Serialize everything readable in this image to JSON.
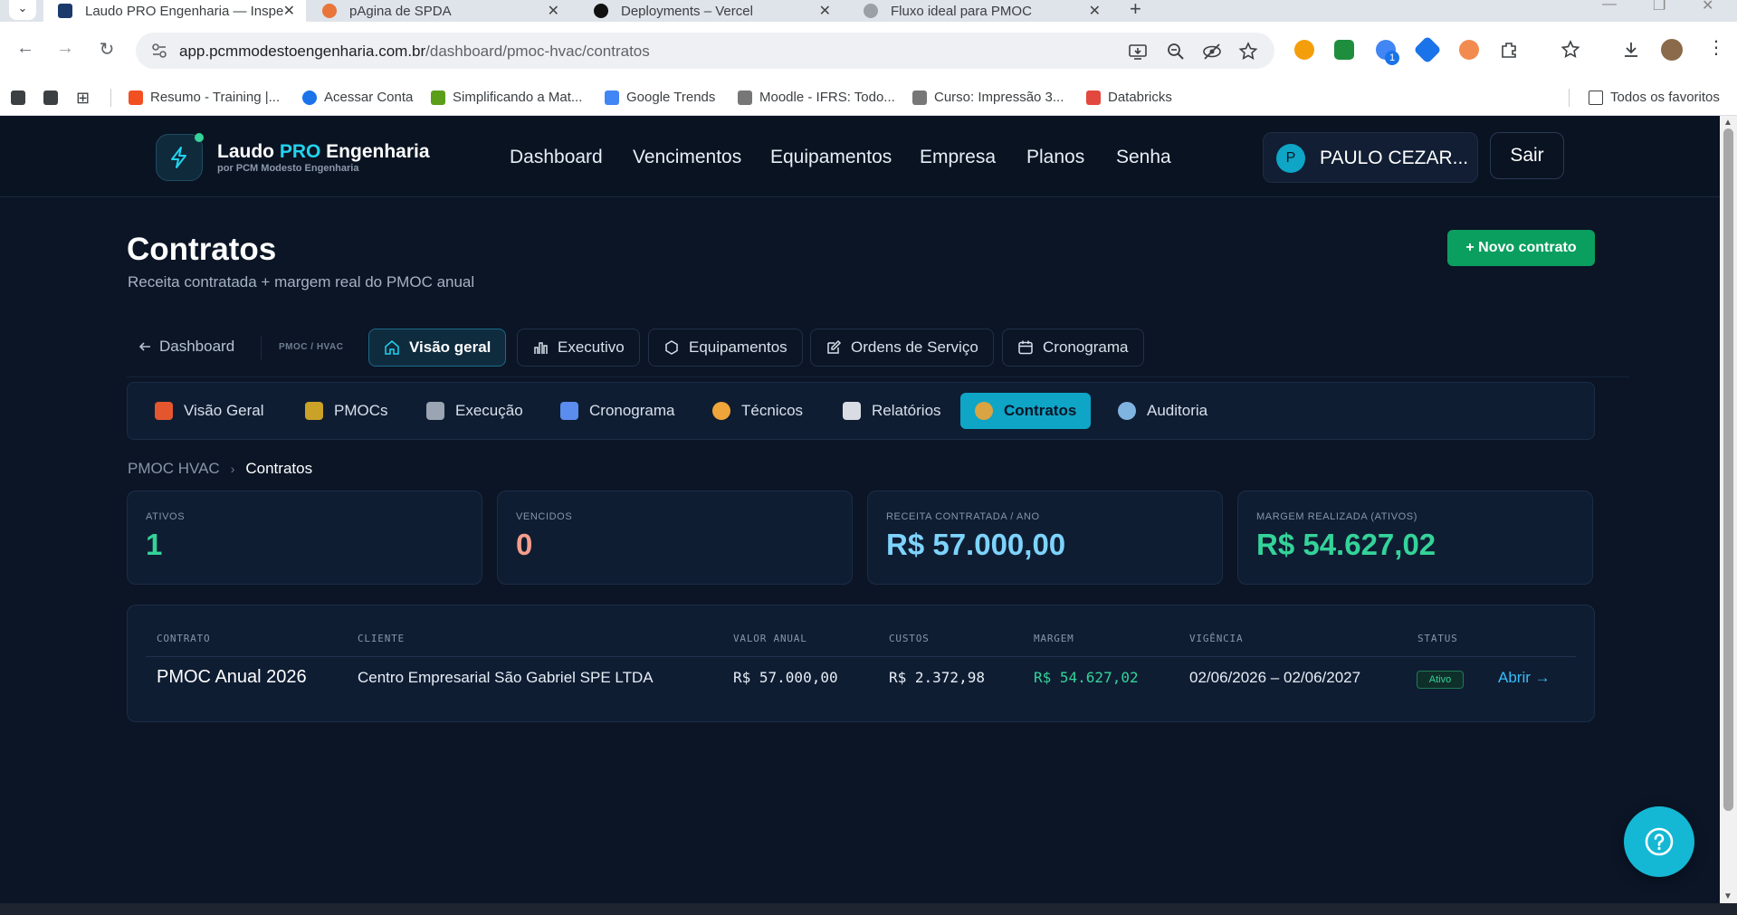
{
  "browser": {
    "tabs": [
      {
        "label": "Laudo PRO Engenharia — Inspe",
        "active": true,
        "color": "#1b3a6b"
      },
      {
        "label": "pAgina de SPDA",
        "active": false,
        "color": "#e8753a"
      },
      {
        "label": "Deployments – Vercel",
        "active": false,
        "color": "#111111"
      },
      {
        "label": "Fluxo ideal para PMOC",
        "active": false,
        "color": "#9aa0a6"
      }
    ],
    "url": {
      "host": "app.pcmmodestoengenharia.com.br",
      "path": "/dashboard/pmoc-hvac/contratos"
    },
    "bookmarks": [
      {
        "label": "Resumo - Training |...",
        "color": "#f25022"
      },
      {
        "label": "Acessar Conta",
        "color": "#1a73e8"
      },
      {
        "label": "Simplificando a Mat...",
        "color": "#5a9e1a"
      },
      {
        "label": "Google Trends",
        "color": "#4285f4"
      },
      {
        "label": "Moodle - IFRS: Todo...",
        "color": "#777777"
      },
      {
        "label": "Curso: Impressão 3...",
        "color": "#777777"
      },
      {
        "label": "Databricks",
        "color": "#e2483d"
      }
    ],
    "all_bookmarks_label": "Todos os favoritos",
    "extension_badge": "1"
  },
  "app": {
    "brand": {
      "name_a": "Laudo ",
      "name_pro": "PRO",
      "name_b": " Engenharia",
      "sub": "por PCM Modesto Engenharia"
    },
    "nav": [
      "Dashboard",
      "Vencimentos",
      "Equipamentos",
      "Empresa",
      "Planos",
      "Senha"
    ],
    "user": {
      "initial": "P",
      "name": "PAULO CEZAR..."
    },
    "logout_label": "Sair"
  },
  "page": {
    "title": "Contratos",
    "subtitle": "Receita contratada + margem real do PMOC anual",
    "new_button": "+ Novo contrato"
  },
  "subnav": {
    "back_label": "Dashboard",
    "section_label": "PMOC / HVAC",
    "items": [
      {
        "label": "Visão geral",
        "active": true,
        "icon": "home-icon"
      },
      {
        "label": "Executivo",
        "active": false,
        "icon": "bar-chart-icon"
      },
      {
        "label": "Equipamentos",
        "active": false,
        "icon": "hexagon-icon"
      },
      {
        "label": "Ordens de Serviço",
        "active": false,
        "icon": "edit-icon"
      },
      {
        "label": "Cronograma",
        "active": false,
        "icon": "calendar-icon"
      }
    ]
  },
  "modules": [
    {
      "label": "Visão Geral",
      "icon": "house-emoji-icon",
      "active": false,
      "color": "#e4572e"
    },
    {
      "label": "PMOCs",
      "icon": "clipboard-emoji-icon",
      "active": false,
      "color": "#c9a227"
    },
    {
      "label": "Execução",
      "icon": "wrench-emoji-icon",
      "active": false,
      "color": "#9aa4b2"
    },
    {
      "label": "Cronograma",
      "icon": "calendar-emoji-icon",
      "active": false,
      "color": "#5b8def"
    },
    {
      "label": "Técnicos",
      "icon": "worker-emoji-icon",
      "active": false,
      "color": "#f0a53a"
    },
    {
      "label": "Relatórios",
      "icon": "page-emoji-icon",
      "active": false,
      "color": "#d9dde3"
    },
    {
      "label": "Contratos",
      "icon": "money-bag-emoji-icon",
      "active": true,
      "color": "#d9a441"
    },
    {
      "label": "Auditoria",
      "icon": "magnifier-emoji-icon",
      "active": false,
      "color": "#7fb3e0"
    }
  ],
  "breadcrumb": {
    "parent": "PMOC HVAC",
    "current": "Contratos"
  },
  "stats": [
    {
      "label": "ATIVOS",
      "value": "1",
      "color": "#34d399"
    },
    {
      "label": "VENCIDOS",
      "value": "0",
      "color": "#f59e8b"
    },
    {
      "label": "RECEITA CONTRATADA / ANO",
      "value": "R$ 57.000,00",
      "color": "#7dd3fc"
    },
    {
      "label": "MARGEM REALIZADA (ATIVOS)",
      "value": "R$ 54.627,02",
      "color": "#34d399"
    }
  ],
  "table": {
    "headers": [
      "CONTRATO",
      "CLIENTE",
      "VALOR ANUAL",
      "CUSTOS",
      "MARGEM",
      "VIGÊNCIA",
      "STATUS"
    ],
    "rows": [
      {
        "contrato": "PMOC Anual 2026",
        "cliente": "Centro Empresarial São Gabriel SPE LTDA",
        "valor_anual": "R$ 57.000,00",
        "custos": "R$ 2.372,98",
        "margem": "R$ 54.627,02",
        "vigencia": "02/06/2026 – 02/06/2027",
        "status": "Ativo",
        "action": "Abrir →"
      }
    ]
  },
  "colors": {
    "accent": "#0ea5c6",
    "success": "#0b9f5f",
    "background": "#0b1526"
  }
}
